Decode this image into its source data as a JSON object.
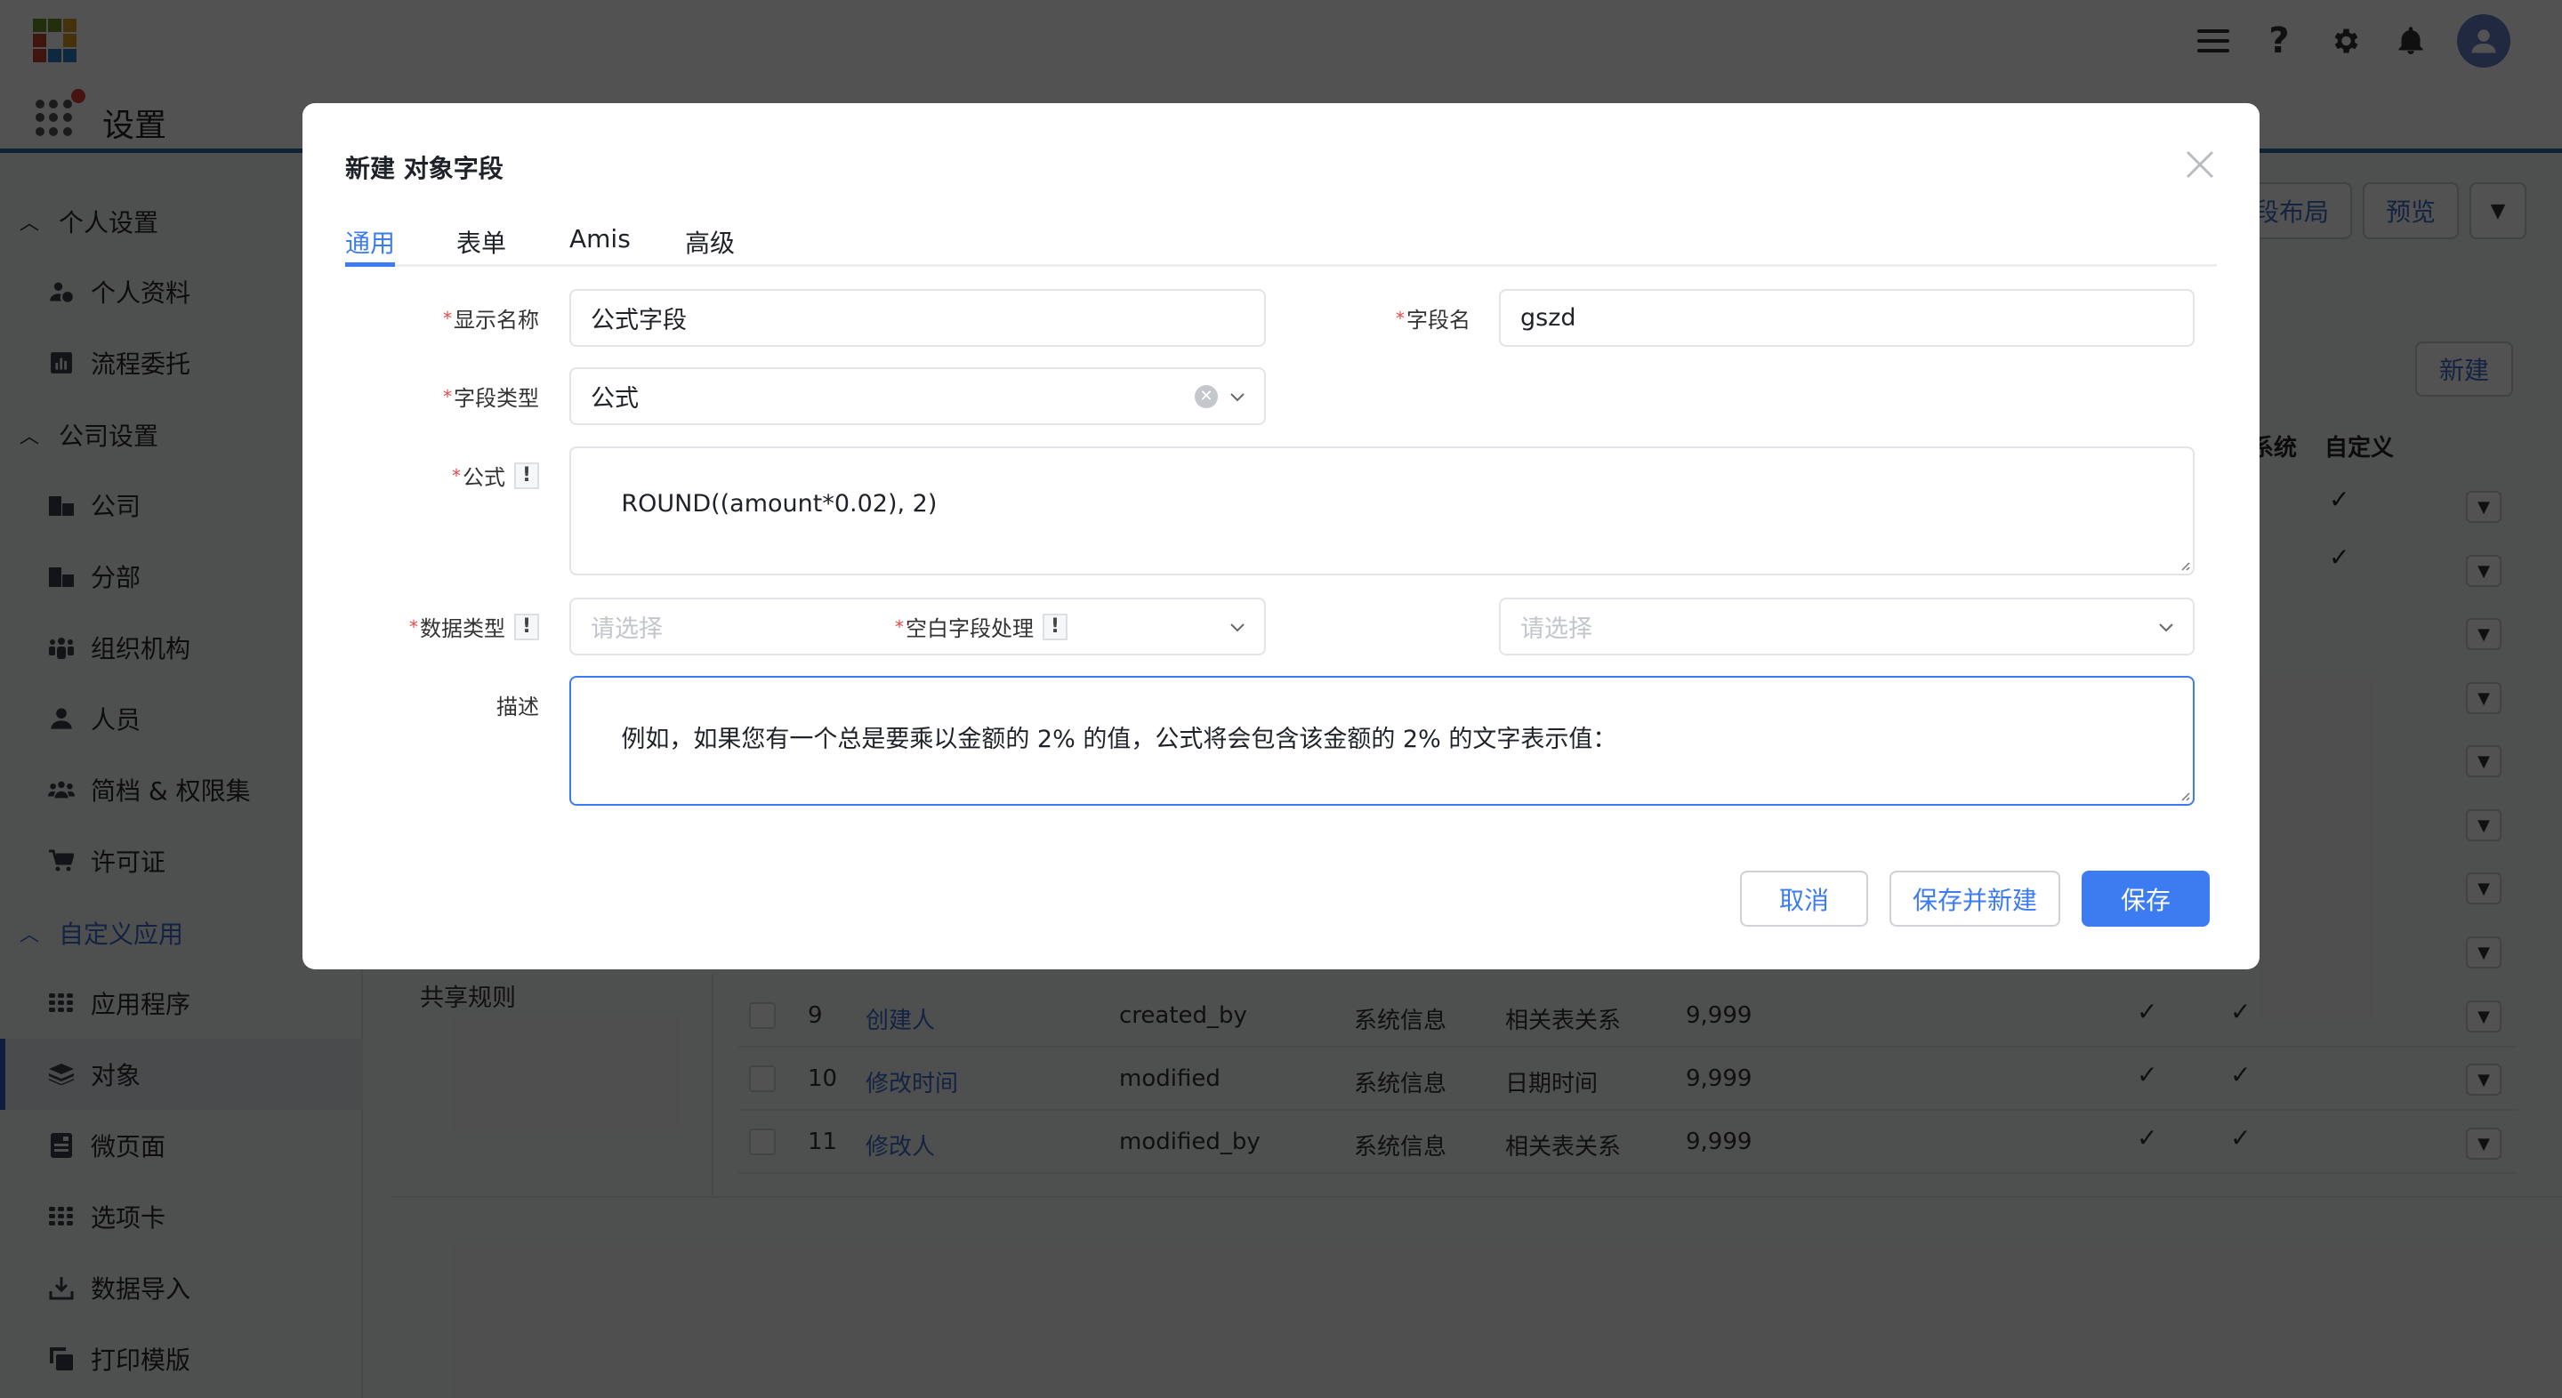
{
  "app": {
    "title": "设置",
    "logo_colors": [
      "#6b8f2e",
      "#6b8f2e",
      "#d89a2a",
      "#c0442f",
      "#ffffff",
      "#d89a2a",
      "#c0442f",
      "#2c7cc4",
      "#2c7cc4"
    ],
    "header_icons": [
      "menu-icon",
      "help-icon",
      "gear-icon",
      "bell-icon",
      "avatar"
    ]
  },
  "sidebar": {
    "groups": [
      {
        "label": "个人设置",
        "items": [
          {
            "label": "个人资料",
            "icon": "user-gear-icon"
          },
          {
            "label": "流程委托",
            "icon": "chart-bar-icon"
          }
        ]
      },
      {
        "label": "公司设置",
        "items": [
          {
            "label": "公司",
            "icon": "building-icon"
          },
          {
            "label": "分部",
            "icon": "building-icon"
          },
          {
            "label": "组织机构",
            "icon": "org-icon"
          },
          {
            "label": "人员",
            "icon": "user-icon"
          },
          {
            "label": "简档 & 权限集",
            "icon": "users-icon"
          },
          {
            "label": "许可证",
            "icon": "cart-icon"
          }
        ]
      },
      {
        "label": "自定义应用",
        "active": true,
        "items": [
          {
            "label": "应用程序",
            "icon": "grid-icon"
          },
          {
            "label": "对象",
            "icon": "layers-icon",
            "selected": true
          },
          {
            "label": "微页面",
            "icon": "page-icon"
          },
          {
            "label": "选项卡",
            "icon": "grid-icon"
          },
          {
            "label": "数据导入",
            "icon": "download-icon"
          },
          {
            "label": "打印模版",
            "icon": "copy-icon"
          }
        ]
      }
    ]
  },
  "background": {
    "header_buttons": [
      "字段布局",
      "预览"
    ],
    "new_button": "新建",
    "columns": {
      "system": "系统",
      "custom": "自定义"
    },
    "left_panel_item": "共享规则",
    "rows": [
      {
        "index": "9",
        "label": "创建人",
        "name": "created_by",
        "group": "系统信息",
        "type": "相关表关系",
        "sort": "9,999",
        "check1": "✓",
        "check2": "✓"
      },
      {
        "index": "10",
        "label": "修改时间",
        "name": "modified",
        "group": "系统信息",
        "type": "日期时间",
        "sort": "9,999",
        "check1": "✓",
        "check2": "✓"
      },
      {
        "index": "11",
        "label": "修改人",
        "name": "modified_by",
        "group": "系统信息",
        "type": "相关表关系",
        "sort": "9,999",
        "check1": "✓",
        "check2": "✓"
      }
    ],
    "custom_checks_top_rows": [
      "✓",
      "✓"
    ]
  },
  "modal": {
    "title": "新建 对象字段",
    "tabs": [
      {
        "label": "通用",
        "active": true
      },
      {
        "label": "表单"
      },
      {
        "label": "Amis"
      },
      {
        "label": "高级"
      }
    ],
    "fields": {
      "display_name": {
        "label": "显示名称",
        "required": "*",
        "value": "公式字段"
      },
      "field_name": {
        "label": "字段名",
        "required": "*",
        "value": "gszd"
      },
      "field_type": {
        "label": "字段类型",
        "required": "*",
        "value": "公式"
      },
      "formula": {
        "label": "公式",
        "required": "*",
        "hint": "!",
        "value": "ROUND((amount*0.02), 2)"
      },
      "data_type": {
        "label": "数据类型",
        "required": "*",
        "hint": "!",
        "placeholder": "请选择"
      },
      "blank_handling": {
        "label": "空白字段处理",
        "required": "*",
        "hint": "!",
        "placeholder": "请选择"
      },
      "description": {
        "label": "描述",
        "value": "例如，如果您有一个总是要乘以金额的 2% 的值，公式将会包含该金额的 2% 的文字表示值："
      }
    },
    "buttons": {
      "cancel": "取消",
      "save_and_new": "保存并新建",
      "save": "保存"
    },
    "accent_color": "#3c7bf0"
  }
}
